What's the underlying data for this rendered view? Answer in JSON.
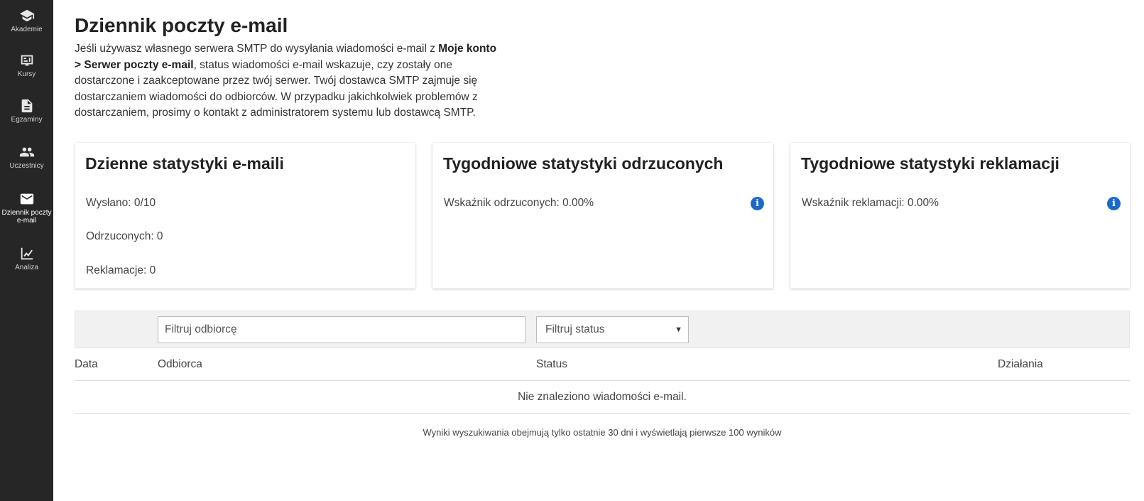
{
  "sidebar": {
    "items": [
      {
        "label": "Akademie",
        "icon": "graduation-cap-icon"
      },
      {
        "label": "Kursy",
        "icon": "courses-icon"
      },
      {
        "label": "Egzaminy",
        "icon": "document-icon"
      },
      {
        "label": "Uczestnicy",
        "icon": "people-icon"
      },
      {
        "label": "Dziennik poczty e-mail",
        "icon": "envelope-icon",
        "active": true
      },
      {
        "label": "Analiza",
        "icon": "chart-icon"
      }
    ]
  },
  "page": {
    "title": "Dziennik poczty e-mail",
    "intro_part1": "Jeśli używasz własnego serwera SMTP do wysyłania wiadomości e-mail z ",
    "intro_bold": "Moje konto > Serwer poczty e-mail",
    "intro_part2": ", status wiadomości e-mail wskazuje, czy zostały one dostarczone i zaakceptowane przez twój serwer. Twój dostawca SMTP zajmuje się dostarczaniem wiadomości do odbiorców. W przypadku jakichkolwiek problemów z dostarczaniem, prosimy o kontakt z administratorem systemu lub dostawcą SMTP."
  },
  "cards": {
    "daily": {
      "title": "Dzienne statystyki e-maili",
      "sent": "Wysłano: 0/10",
      "rejected": "Odrzuconych: 0",
      "complaints": "Reklamacje: 0"
    },
    "weekly_rejected": {
      "title": "Tygodniowe statystyki odrzuconych",
      "rate": "Wskaźnik odrzuconych: 0.00%"
    },
    "weekly_complaints": {
      "title": "Tygodniowe statystyki reklamacji",
      "rate": "Wskaźnik reklamacji: 0.00%"
    }
  },
  "filters": {
    "recipient_placeholder": "Filtruj odbiorcę",
    "status_selected": "Filtruj status"
  },
  "table": {
    "columns": [
      "Data",
      "Odbiorca",
      "Status",
      "Działania"
    ],
    "empty_message": "Nie znaleziono wiadomości e-mail."
  },
  "footer_note": "Wyniki wyszukiwania obejmują tylko ostatnie 30 dni i wyświetlają pierwsze 100 wyników",
  "colors": {
    "sidebar_bg": "#262626",
    "info_blue": "#1b6ac9",
    "filter_bar_bg": "#f1f1f1"
  }
}
